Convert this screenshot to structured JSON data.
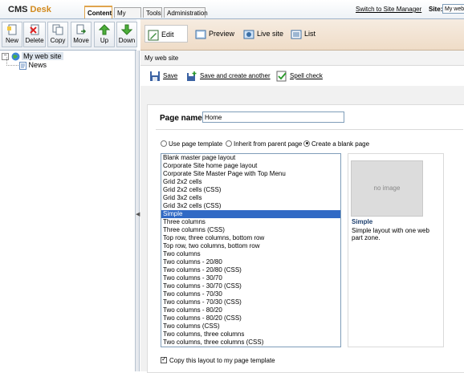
{
  "header": {
    "logo_main": "CMS",
    "logo_accent": "Desk",
    "tabs": [
      "Content",
      "My Desk",
      "Tools",
      "Administration"
    ],
    "switch_link": "Switch to Site Manager",
    "site_label": "Site:",
    "site_value": "My web"
  },
  "toolbar": {
    "buttons": [
      "New",
      "Delete",
      "Copy",
      "Move",
      "Up",
      "Down"
    ]
  },
  "tree": {
    "root": "My web site",
    "child": "News"
  },
  "modes": [
    "Edit",
    "Preview",
    "Live site",
    "List"
  ],
  "breadcrumb": "My web site",
  "actions": {
    "save": "Save",
    "save_create": "Save and create another",
    "spell": "Spell check"
  },
  "form": {
    "page_name_label": "Page name:",
    "page_name_value": "Home",
    "radios": [
      "Use page template",
      "Inherit from parent page",
      "Create a blank page"
    ],
    "selected_radio": "Create a blank page",
    "layouts": [
      "Blank master page layout",
      "Corporate Site home page layout",
      "Corporate Site Master Page with Top Menu",
      "Grid 2x2 cells",
      "Grid 2x2 cells (CSS)",
      "Grid 3x2 cells",
      "Grid 3x2 cells (CSS)",
      "Simple",
      "Three columns",
      "Three columns (CSS)",
      "Top row, three columns, bottom row",
      "Top row, two columns, bottom row",
      "Two columns",
      "Two columns - 20/80",
      "Two columns - 20/80 (CSS)",
      "Two columns - 30/70",
      "Two columns - 30/70 (CSS)",
      "Two columns - 70/30",
      "Two columns - 70/30 (CSS)",
      "Two columns - 80/20",
      "Two columns - 80/20 (CSS)",
      "Two columns (CSS)",
      "Two columns, three columns",
      "Two columns, three columns (CSS)"
    ],
    "selected_layout": "Simple",
    "preview": {
      "image_text": "no image",
      "name": "Simple",
      "description": "Simple layout with one web part zone."
    },
    "copy_checkbox": "Copy this layout to my page template"
  },
  "colors": {
    "accent_tab": "#e0a44d",
    "selection": "#316ac5",
    "mode_bar": "#efdcc7"
  }
}
